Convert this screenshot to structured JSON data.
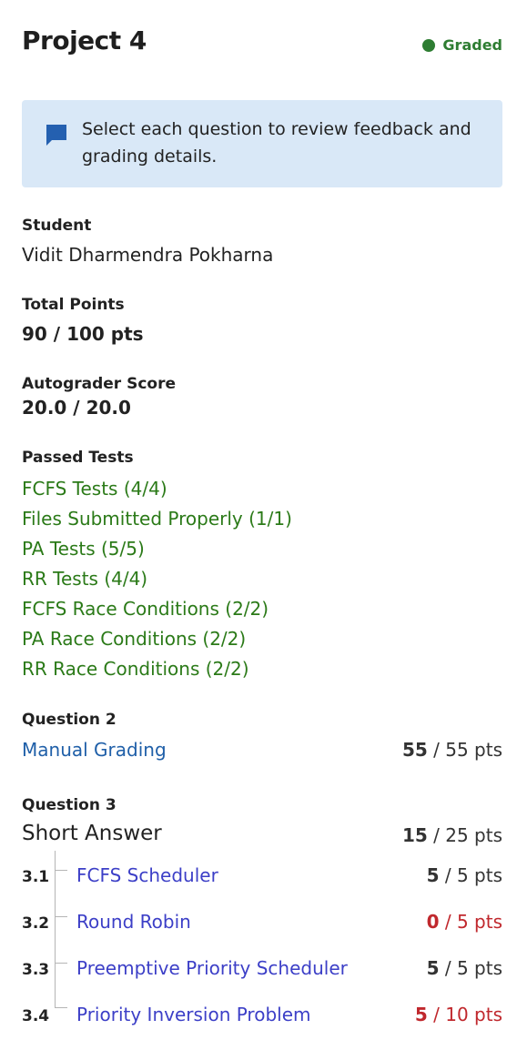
{
  "header": {
    "title": "Project 4",
    "status": "Graded"
  },
  "notice": {
    "text": "Select each question to review feedback and grading details."
  },
  "student": {
    "label": "Student",
    "value": "Vidit Dharmendra Pokharna"
  },
  "total_points": {
    "label": "Total Points",
    "value": "90 / 100 pts"
  },
  "autograder": {
    "label": "Autograder Score",
    "value": "20.0 / 20.0",
    "passed_label": "Passed Tests",
    "tests": [
      "FCFS Tests (4/4)",
      "Files Submitted Properly (1/1)",
      "PA Tests (5/5)",
      "RR Tests (4/4)",
      "FCFS Race Conditions (2/2)",
      "PA Race Conditions (2/2)",
      "RR Race Conditions (2/2)"
    ]
  },
  "question2": {
    "label": "Question 2",
    "title": "Manual Grading",
    "score": "55",
    "max": " / 55 pts"
  },
  "question3": {
    "label": "Question 3",
    "title": "Short Answer",
    "score": "15",
    "max": " / 25 pts",
    "subs": [
      {
        "num": "3.1",
        "title": "FCFS Scheduler",
        "score": "5",
        "max": " / 5 pts",
        "color": "#333333"
      },
      {
        "num": "3.2",
        "title": "Round Robin",
        "score": "0",
        "max": " / 5 pts",
        "color": "#c0282d"
      },
      {
        "num": "3.3",
        "title": "Preemptive Priority Scheduler",
        "score": "5",
        "max": " / 5 pts",
        "color": "#333333"
      },
      {
        "num": "3.4",
        "title": "Priority Inversion Problem",
        "score": "5",
        "max": " / 10 pts",
        "color": "#c0282d"
      }
    ]
  },
  "colors": {
    "graded": "#2e7d32",
    "link": "#1f5fa8",
    "passed": "#2b7a18",
    "lost": "#c0282d",
    "notice_bg": "#d9e8f7"
  }
}
